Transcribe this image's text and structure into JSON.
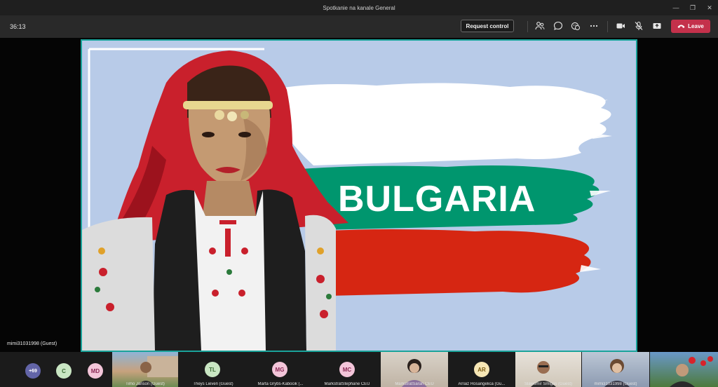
{
  "window": {
    "title": "Spotkanie na kanale General",
    "controls": [
      "minimize",
      "restore",
      "close"
    ]
  },
  "toolbar": {
    "timer": "36:13",
    "request_control_label": "Request control",
    "icons": [
      "participants-icon",
      "chat-icon",
      "reactions-icon",
      "more-icon",
      "camera-icon",
      "mic-muted-icon",
      "share-icon"
    ],
    "leave_label": "Leave",
    "leave_color": "#c4314b"
  },
  "slide": {
    "headline": "BULGARIA",
    "flag_colors": {
      "white": "#ffffff",
      "green": "#00966e",
      "red": "#d62612"
    },
    "background": "#b8cbe8"
  },
  "presenter": {
    "name": "mimi31031998 (Guest)"
  },
  "participants": {
    "overflow_count": "+69",
    "tiles": [
      {
        "initials": "C",
        "name": "",
        "avatar_bg": "#c9e6c3",
        "avatar_fg": "#3a6b33"
      },
      {
        "initials": "MD",
        "name": "",
        "avatar_bg": "#f3c5d9",
        "avatar_fg": "#8a2a55"
      },
      {
        "initials": "",
        "name": "Timo Janson (Guest)",
        "video": true
      },
      {
        "initials": "TL",
        "name": "Theys Lieven (Guest)",
        "avatar_bg": "#c9e6c3",
        "avatar_fg": "#3a6b33"
      },
      {
        "initials": "MG",
        "name": "Marta Grybś-Kabocik (...",
        "avatar_bg": "#f3c5d9",
        "avatar_fg": "#8a2a55"
      },
      {
        "initials": "MC",
        "name": "MarkstratStephane CEU",
        "avatar_bg": "#f3c5d9",
        "avatar_fg": "#8a2a55"
      },
      {
        "initials": "",
        "name": "MarkstratSarah CEU",
        "video": true
      },
      {
        "initials": "AR",
        "name": "Arraiz Rosangelica (Gu...",
        "avatar_bg": "#f6e6b5",
        "avatar_fg": "#7a5a10"
      },
      {
        "initials": "",
        "name": "Slawomir Smigas (Guest)",
        "video": true
      },
      {
        "initials": "",
        "name": "mimi31031998 (Guest)",
        "video": true
      },
      {
        "initials": "",
        "name": "",
        "video": true
      }
    ]
  }
}
